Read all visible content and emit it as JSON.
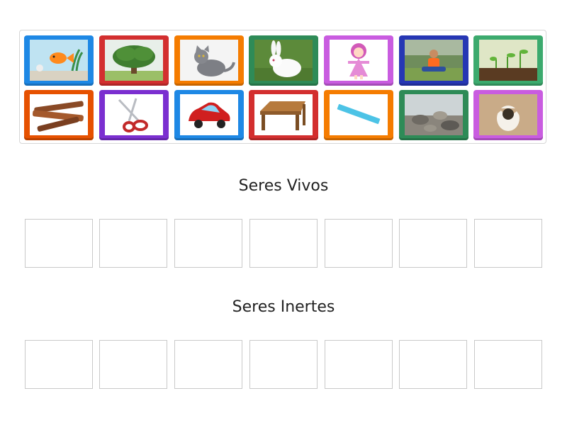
{
  "card_bank": {
    "cards": [
      {
        "name": "goldfish-aquarium",
        "frame_color": "#1e88e5"
      },
      {
        "name": "tree",
        "frame_color": "#d32f2f"
      },
      {
        "name": "gray-cat",
        "frame_color": "#f57c00"
      },
      {
        "name": "white-rabbit",
        "frame_color": "#2e8b57"
      },
      {
        "name": "doll",
        "frame_color": "#c95ce0"
      },
      {
        "name": "child-sitting",
        "frame_color": "#2637b4"
      },
      {
        "name": "sprouts",
        "frame_color": "#3caa6e"
      },
      {
        "name": "wood-sticks",
        "frame_color": "#e65100"
      },
      {
        "name": "scissors",
        "frame_color": "#7b2fd0"
      },
      {
        "name": "toy-car",
        "frame_color": "#1e88e5"
      },
      {
        "name": "wooden-table",
        "frame_color": "#d32f2f"
      },
      {
        "name": "ruler",
        "frame_color": "#f57c00"
      },
      {
        "name": "rocks",
        "frame_color": "#2e8b57"
      },
      {
        "name": "hatching-egg",
        "frame_color": "#c95ce0"
      }
    ]
  },
  "groups": {
    "living": {
      "title": "Seres Vivos"
    },
    "nonliving": {
      "title": "Seres Inertes"
    }
  }
}
